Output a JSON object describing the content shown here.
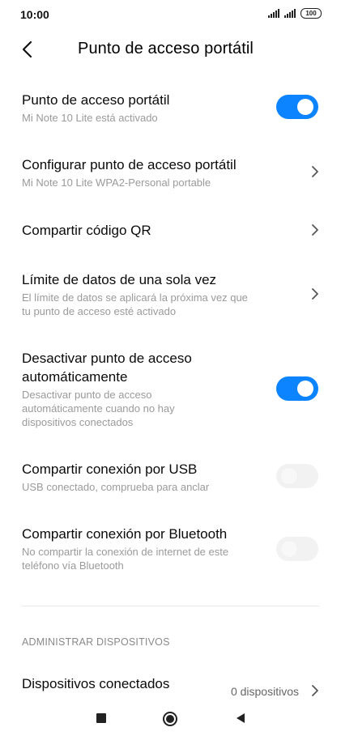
{
  "status_bar": {
    "time": "10:00",
    "battery": "100",
    "icons": [
      "signal-icon",
      "signal-icon",
      "battery-icon"
    ]
  },
  "header": {
    "title": "Punto de acceso portátil",
    "back_icon": "back-arrow-icon"
  },
  "settings": [
    {
      "label": "Punto de acceso portátil",
      "sub": "Mi Note 10 Lite está activado",
      "control": "toggle",
      "on": true
    },
    {
      "label": "Configurar punto de acceso portátil",
      "sub": "Mi Note 10 Lite WPA2-Personal portable",
      "control": "chevron"
    },
    {
      "label": "Compartir código QR",
      "control": "chevron"
    },
    {
      "label": "Límite de datos de una sola vez",
      "sub_line1": "El límite de datos se aplicará la próxima vez que",
      "sub_line2": "tu punto de acceso esté activado",
      "control": "chevron"
    },
    {
      "label_line1": "Desactivar punto de acceso",
      "label_line2": "automáticamente",
      "sub_line1": "Desactivar punto de acceso",
      "sub_line2": "automáticamente cuando no hay",
      "sub_line3": "dispositivos conectados",
      "control": "toggle",
      "on": true
    },
    {
      "label": "Compartir conexión por USB",
      "sub": "USB conectado, comprueba para anclar",
      "control": "toggle",
      "on": false
    },
    {
      "label": "Compartir conexión por Bluetooth",
      "sub_line1": "No compartir la conexión de internet de este",
      "sub_line2": "teléfono vía Bluetooth",
      "control": "toggle",
      "on": false
    }
  ],
  "section": {
    "title": "ADMINISTRAR DISPOSITIVOS"
  },
  "devices_row": {
    "label": "Dispositivos conectados",
    "value": "0 dispositivos",
    "control": "chevron"
  },
  "nav_bar": {
    "icons": [
      "recents-icon",
      "home-icon",
      "back-icon"
    ]
  },
  "colors": {
    "accent": "#0d84ff",
    "sub_text": "#9a9a9a",
    "toggle_off": "#f2f2f2"
  }
}
